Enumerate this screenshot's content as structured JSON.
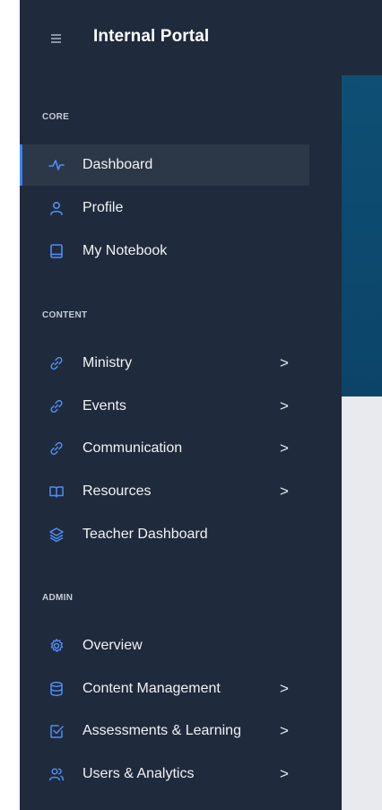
{
  "app": {
    "title": "Internal Portal"
  },
  "sections": {
    "core": "CORE",
    "content": "CONTENT",
    "admin": "ADMIN"
  },
  "nav": {
    "dashboard": "Dashboard",
    "profile": "Profile",
    "notebook": "My Notebook",
    "ministry": "Ministry",
    "events": "Events",
    "communication": "Communication",
    "resources": "Resources",
    "teacher_dashboard": "Teacher Dashboard",
    "overview": "Overview",
    "content_management": "Content Management",
    "assessments": "Assessments & Learning",
    "users_analytics": "Users & Analytics"
  },
  "chevron": ">",
  "colors": {
    "sidebar_bg": "#1f2a3c",
    "active_bg": "#2c3748",
    "active_accent": "#3b82f6",
    "icon_blue": "#4f8ff7",
    "banner": "#0e4f75"
  }
}
